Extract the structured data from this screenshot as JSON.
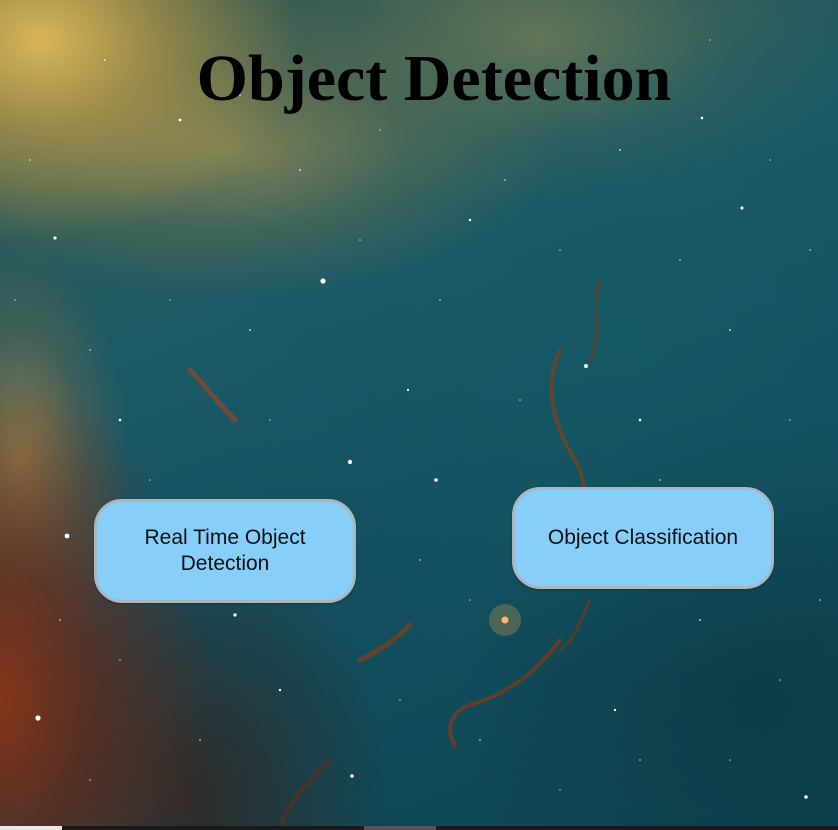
{
  "page": {
    "title": "Object Detection"
  },
  "buttons": {
    "realtime_label": "Real Time Object Detection",
    "classification_label": "Object Classification"
  },
  "colors": {
    "button_fill": "#87cefa",
    "button_border": "#a9b7bf",
    "title_text": "#000000",
    "background_teal": "#135060",
    "background_gold": "#e2ba58",
    "background_rust": "#8c3214"
  },
  "background": {
    "description_icon": "nebula-background"
  }
}
